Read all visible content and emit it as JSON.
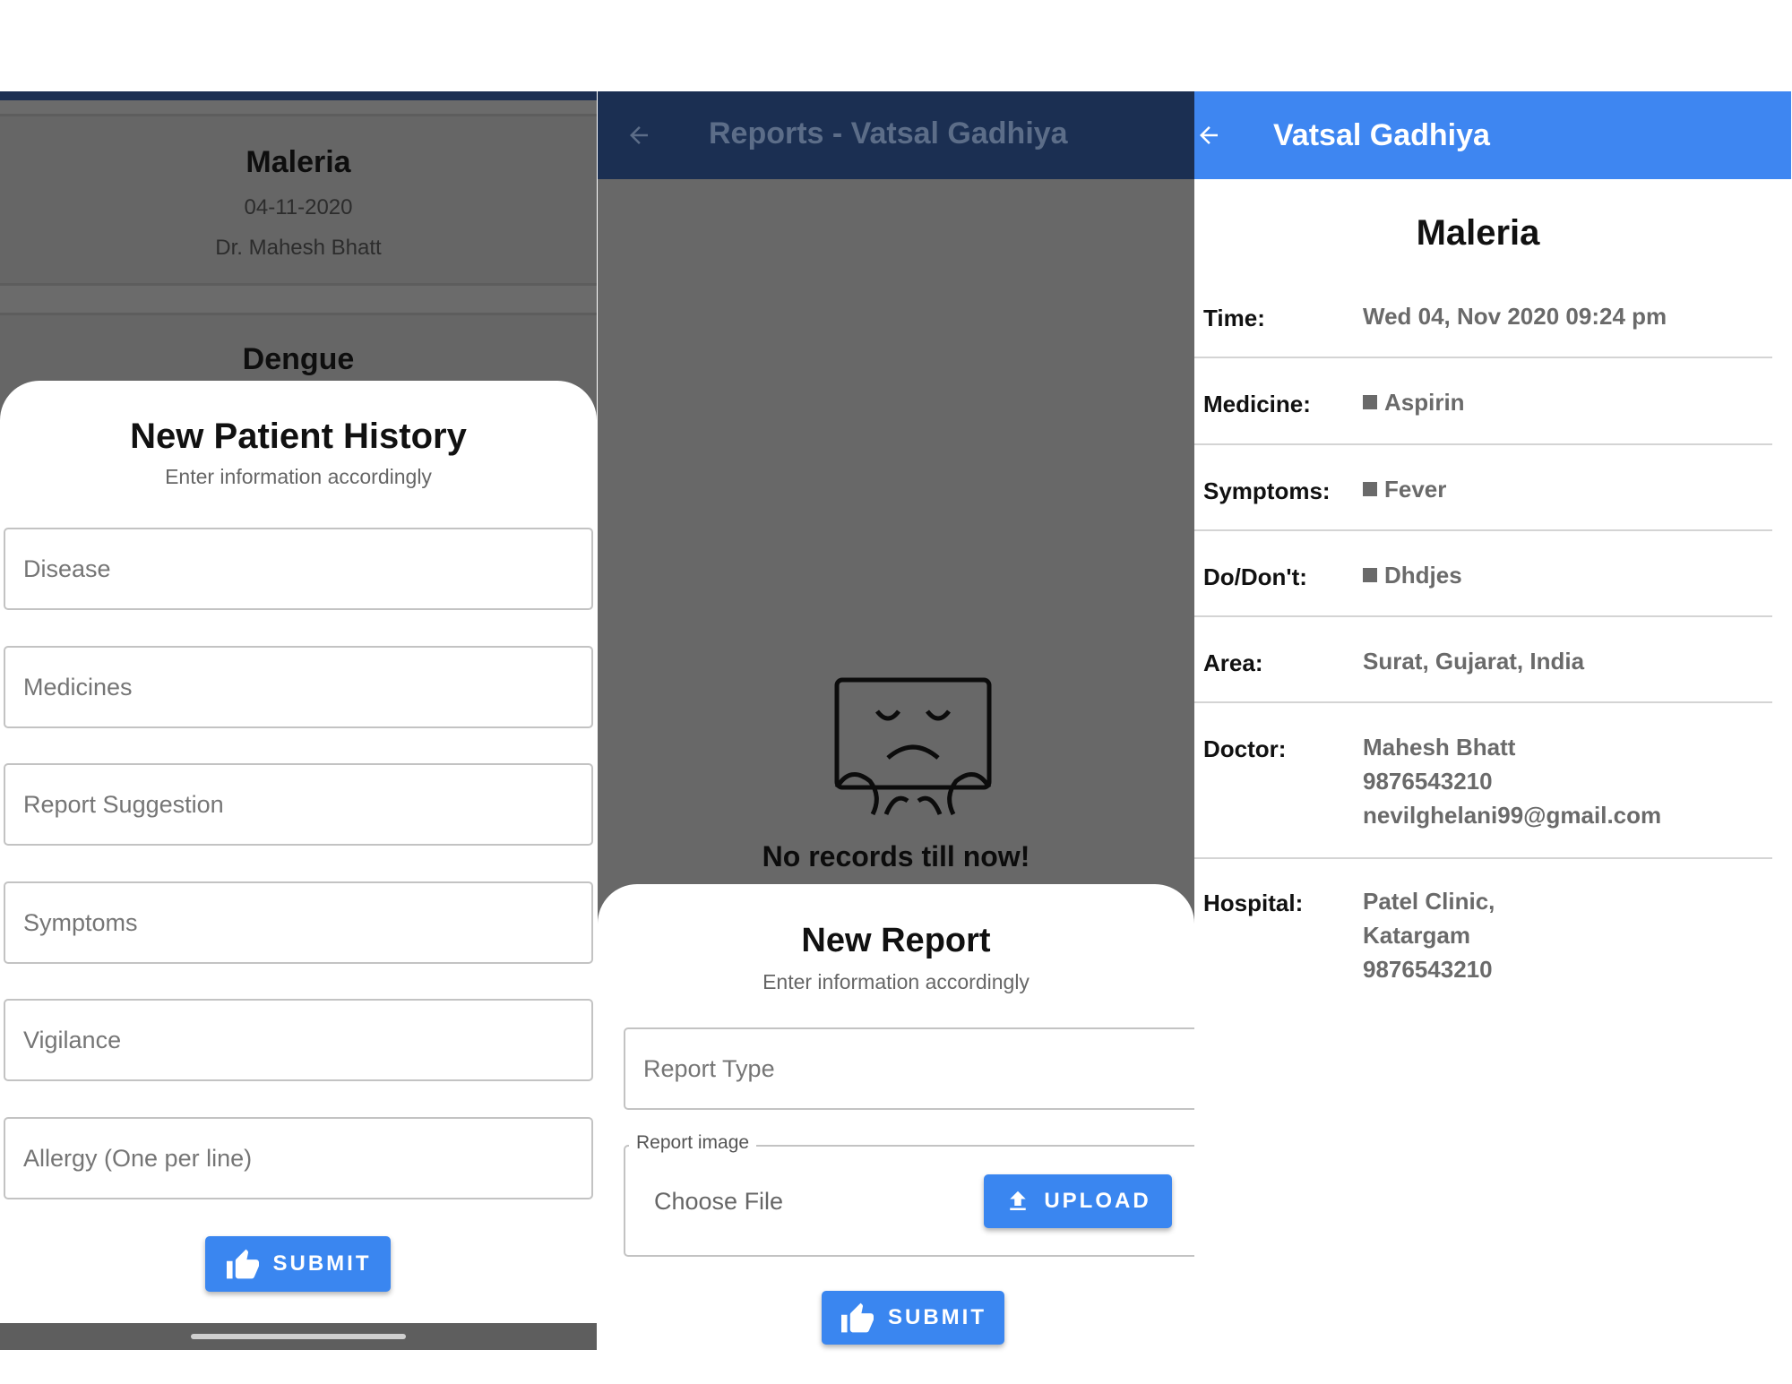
{
  "history_screen": {
    "records": [
      {
        "disease": "Maleria",
        "date": "04-11-2020",
        "doctor": "Dr. Mahesh Bhatt"
      },
      {
        "disease": "Dengue"
      }
    ],
    "sheet": {
      "title": "New Patient History",
      "subtitle": "Enter information accordingly",
      "fields": [
        "Disease",
        "Medicines",
        "Report Suggestion",
        "Symptoms",
        "Vigilance",
        "Allergy (One per line)"
      ],
      "submit_label": "SUBMIT",
      "submit_icon": "thumbs-up-icon"
    }
  },
  "reports_screen": {
    "title": "Reports - Vatsal Gadhiya",
    "back_icon": "arrow-left-icon",
    "empty_icon": "sad-face-icon",
    "empty_text": "No records till now!",
    "sheet": {
      "title": "New Report",
      "subtitle": "Enter information accordingly",
      "report_type_placeholder": "Report Type",
      "image_legend": "Report image",
      "choose_file": "Choose File",
      "upload_label": "UPLOAD",
      "upload_icon": "upload-icon",
      "submit_label": "SUBMIT",
      "submit_icon": "thumbs-up-icon"
    }
  },
  "detail_screen": {
    "title": "Vatsal Gadhiya",
    "back_icon": "arrow-left-icon",
    "disease": "Maleria",
    "rows": {
      "time": {
        "label": "Time:",
        "value": "Wed 04, Nov 2020 09:24 pm"
      },
      "medicine": {
        "label": "Medicine:",
        "value": "Aspirin"
      },
      "symptoms": {
        "label": "Symptoms:",
        "value": "Fever"
      },
      "dodont": {
        "label": "Do/Don't:",
        "value": "Dhdjes"
      },
      "area": {
        "label": "Area:",
        "value": "Surat, Gujarat, India"
      },
      "doctor": {
        "label": "Doctor:",
        "lines": [
          "Mahesh Bhatt",
          "9876543210",
          "nevilghelani99@gmail.com"
        ]
      },
      "hospital": {
        "label": "Hospital:",
        "lines": [
          "Patel Clinic,",
          "Katargam",
          "9876543210"
        ]
      }
    }
  },
  "colors": {
    "primary": "#3e86f1",
    "dark_appbar": "#1b2f52",
    "overlay": "#686868"
  }
}
